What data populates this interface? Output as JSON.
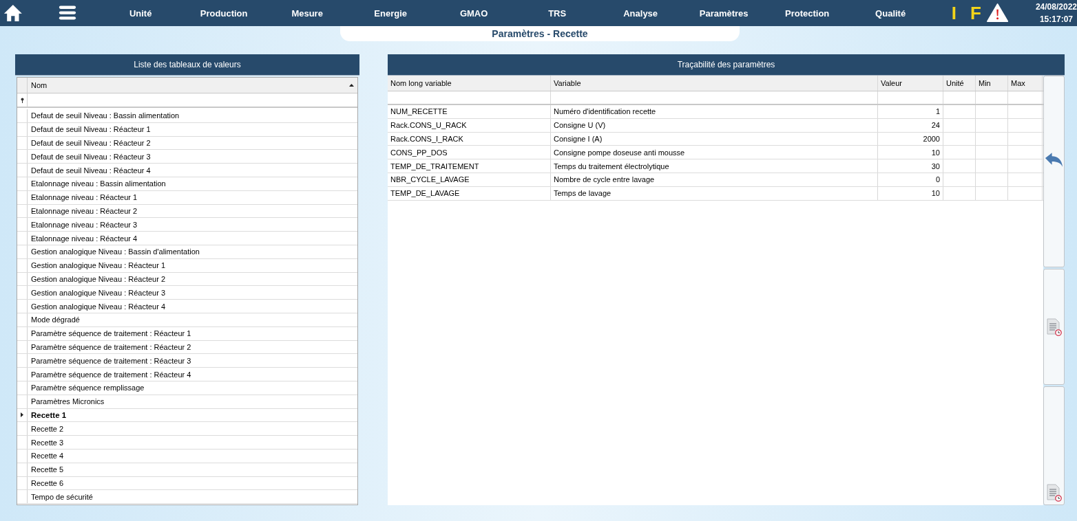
{
  "nav": {
    "items": [
      "Unité",
      "Production",
      "Mesure",
      "Energie",
      "GMAO",
      "TRS",
      "Analyse",
      "Paramètres",
      "Protection",
      "Qualité"
    ],
    "indicators": [
      "I",
      "F"
    ],
    "date": "24/08/2022",
    "time": "15:17:07"
  },
  "page_title": "Paramètres - Recette",
  "value_tables": {
    "title": "Liste des tableaux de valeurs",
    "column": "Nom",
    "rows": [
      {
        "name": "Defaut de seuil Niveau : Bassin alimentation",
        "selected": false
      },
      {
        "name": "Defaut de seuil Niveau : Réacteur 1",
        "selected": false
      },
      {
        "name": "Defaut de seuil Niveau : Réacteur 2",
        "selected": false
      },
      {
        "name": "Defaut de seuil Niveau : Réacteur 3",
        "selected": false
      },
      {
        "name": "Defaut de seuil Niveau : Réacteur 4",
        "selected": false
      },
      {
        "name": "Etalonnage niveau : Bassin alimentation",
        "selected": false
      },
      {
        "name": "Etalonnage niveau : Réacteur 1",
        "selected": false
      },
      {
        "name": "Etalonnage niveau : Réacteur 2",
        "selected": false
      },
      {
        "name": "Etalonnage niveau : Réacteur 3",
        "selected": false
      },
      {
        "name": "Etalonnage niveau : Réacteur 4",
        "selected": false
      },
      {
        "name": "Gestion analogique Niveau : Bassin d'alimentation",
        "selected": false
      },
      {
        "name": "Gestion analogique Niveau : Réacteur 1",
        "selected": false
      },
      {
        "name": "Gestion analogique Niveau : Réacteur 2",
        "selected": false
      },
      {
        "name": "Gestion analogique Niveau : Réacteur 3",
        "selected": false
      },
      {
        "name": "Gestion analogique Niveau : Réacteur 4",
        "selected": false
      },
      {
        "name": "Mode dégradé",
        "selected": false
      },
      {
        "name": "Paramètre séquence de traitement : Réacteur 1",
        "selected": false
      },
      {
        "name": "Paramètre séquence de traitement : Réacteur 2",
        "selected": false
      },
      {
        "name": "Paramètre séquence de traitement : Réacteur 3",
        "selected": false
      },
      {
        "name": "Paramètre séquence de traitement : Réacteur 4",
        "selected": false
      },
      {
        "name": "Paramètre séquence remplissage",
        "selected": false
      },
      {
        "name": "Paramètres Micronics",
        "selected": false
      },
      {
        "name": "Recette 1",
        "selected": true
      },
      {
        "name": "Recette 2",
        "selected": false
      },
      {
        "name": "Recette 3",
        "selected": false
      },
      {
        "name": "Recette 4",
        "selected": false
      },
      {
        "name": "Recette 5",
        "selected": false
      },
      {
        "name": "Recette 6",
        "selected": false
      },
      {
        "name": "Tempo de sécurité",
        "selected": false
      }
    ]
  },
  "traceability": {
    "title": "Traçabilité des paramètres",
    "columns": [
      "Nom long variable",
      "Variable",
      "Valeur",
      "Unité",
      "Min",
      "Max"
    ],
    "rows": [
      [
        "NUM_RECETTE",
        "Numéro d'identification recette",
        "1"
      ],
      [
        "Rack.CONS_U_RACK",
        "Consigne U (V)",
        "24"
      ],
      [
        "Rack.CONS_I_RACK",
        "Consigne I (A)",
        "2000"
      ],
      [
        "CONS_PP_DOS",
        "Consigne pompe doseuse anti mousse",
        "10"
      ],
      [
        "TEMP_DE_TRAITEMENT",
        "Temps du traitement électrolytique",
        "30"
      ],
      [
        "NBR_CYCLE_LAVAGE",
        "Nombre de cycle entre lavage",
        "0"
      ],
      [
        "TEMP_DE_LAVAGE",
        "Temps de lavage",
        "10"
      ]
    ]
  }
}
